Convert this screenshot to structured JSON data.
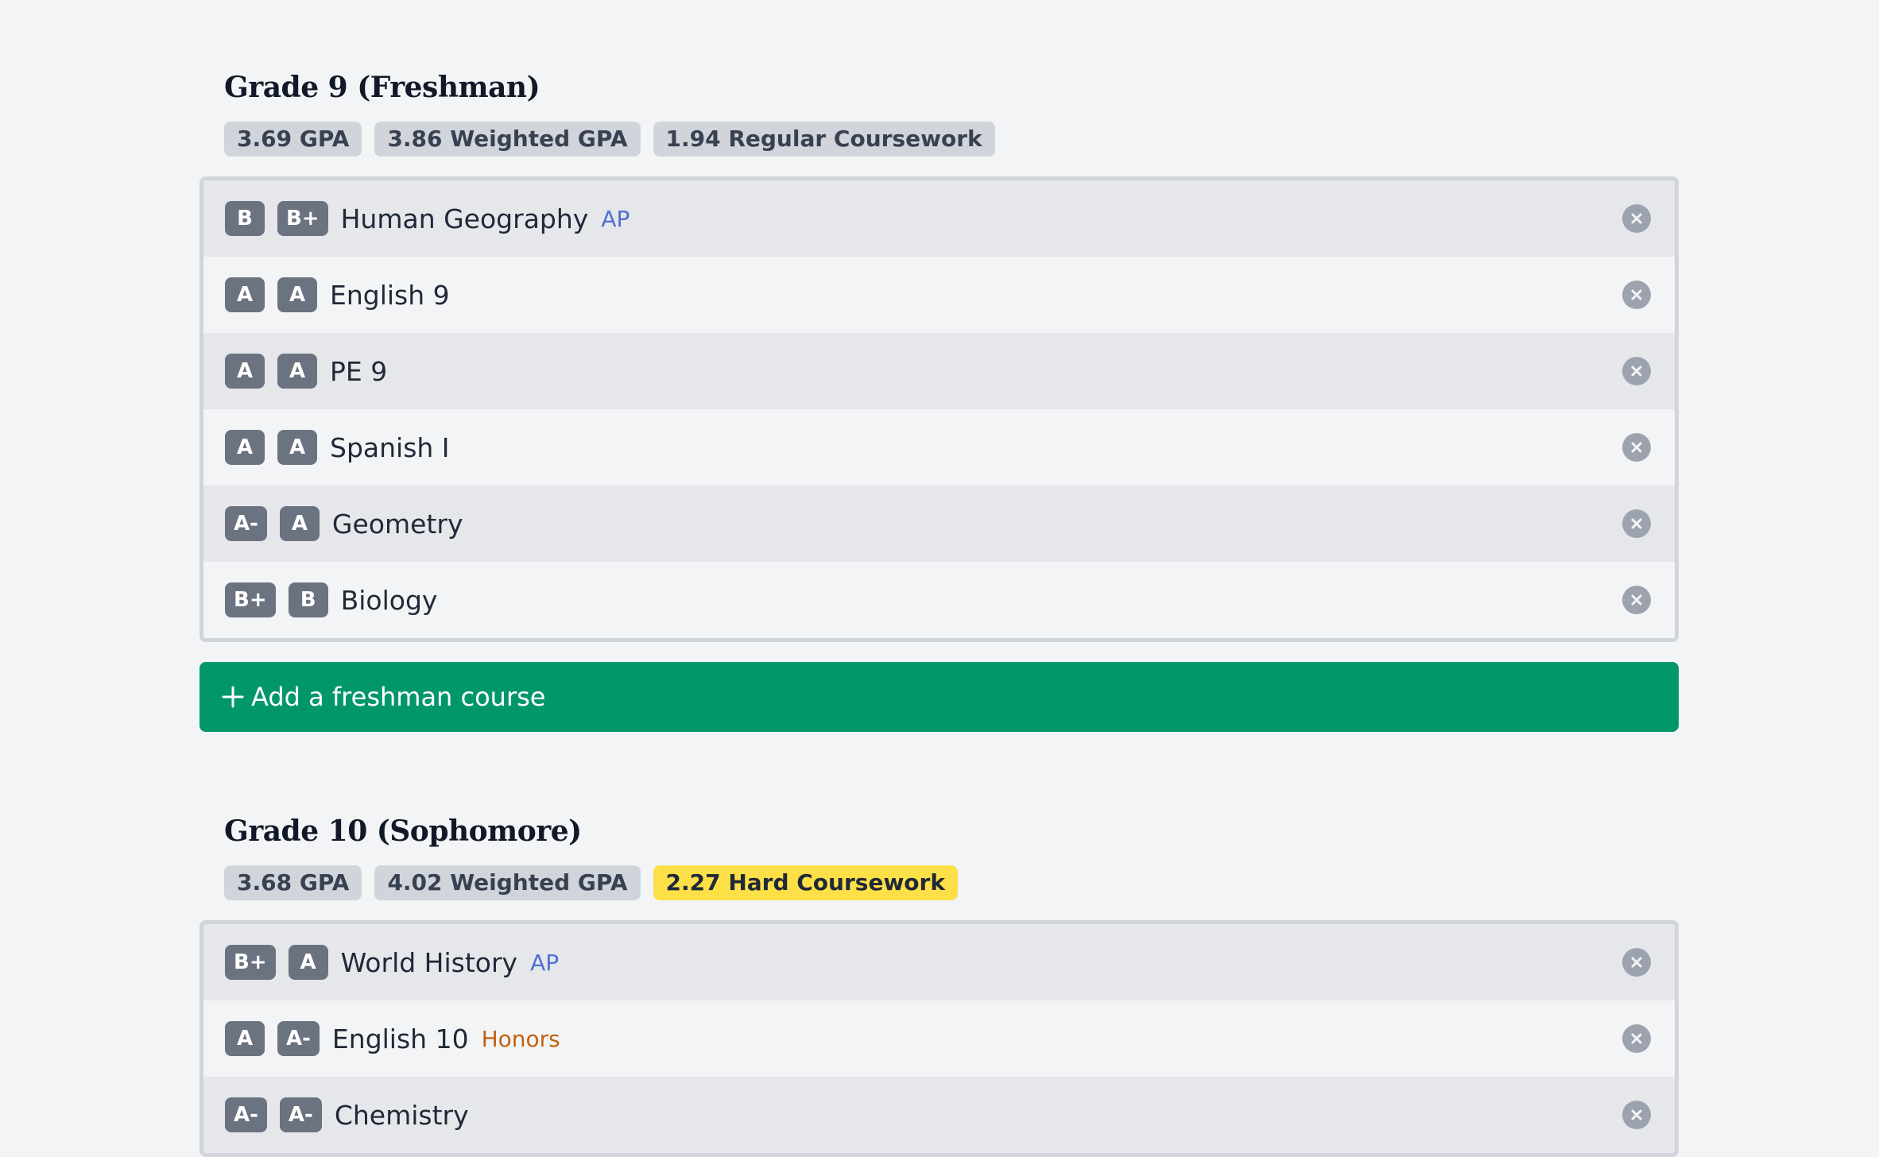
{
  "grades": [
    {
      "title": "Grade 9 (Freshman)",
      "stats": {
        "gpa": "3.69 GPA",
        "weighted_gpa": "3.86 Weighted GPA",
        "coursework": "1.94 Regular Coursework",
        "coursework_level": "regular"
      },
      "courses": [
        {
          "grade1": "B",
          "grade2": "B+",
          "name": "Human Geography",
          "tag": "AP",
          "tag_type": "ap"
        },
        {
          "grade1": "A",
          "grade2": "A",
          "name": "English 9",
          "tag": "",
          "tag_type": ""
        },
        {
          "grade1": "A",
          "grade2": "A",
          "name": "PE 9",
          "tag": "",
          "tag_type": ""
        },
        {
          "grade1": "A",
          "grade2": "A",
          "name": "Spanish I",
          "tag": "",
          "tag_type": ""
        },
        {
          "grade1": "A-",
          "grade2": "A",
          "name": "Geometry",
          "tag": "",
          "tag_type": ""
        },
        {
          "grade1": "B+",
          "grade2": "B",
          "name": "Biology",
          "tag": "",
          "tag_type": ""
        }
      ],
      "add_label": "Add a freshman course"
    },
    {
      "title": "Grade 10 (Sophomore)",
      "stats": {
        "gpa": "3.68 GPA",
        "weighted_gpa": "4.02 Weighted GPA",
        "coursework": "2.27 Hard Coursework",
        "coursework_level": "hard"
      },
      "courses": [
        {
          "grade1": "B+",
          "grade2": "A",
          "name": "World History",
          "tag": "AP",
          "tag_type": "ap"
        },
        {
          "grade1": "A",
          "grade2": "A-",
          "name": "English 10",
          "tag": "Honors",
          "tag_type": "honors"
        },
        {
          "grade1": "A-",
          "grade2": "A-",
          "name": "Chemistry",
          "tag": "",
          "tag_type": ""
        }
      ],
      "add_label": ""
    }
  ],
  "colors": {
    "background": "#f3f4f6",
    "add_button": "#02976b",
    "hard_coursework": "#fde047",
    "ap_tag": "#4f6fd0",
    "honors_tag": "#c2610e",
    "grade_badge": "#6b7280",
    "remove_button": "#9ca3af"
  },
  "icons": {
    "remove": "close-circle-icon",
    "add": "plus-icon"
  }
}
